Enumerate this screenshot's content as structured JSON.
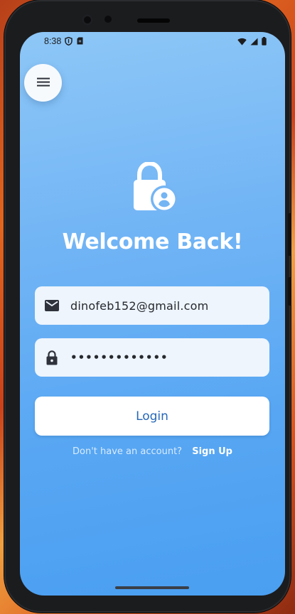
{
  "status_bar": {
    "time": "8:38",
    "left_icons": [
      "shield-icon",
      "sim-card-icon"
    ],
    "right_icons": [
      "wifi-icon",
      "cellular-signal-icon",
      "battery-icon"
    ]
  },
  "menu_button": {
    "icon": "hamburger-menu-icon"
  },
  "hero": {
    "icon": "lock-account-icon"
  },
  "title": "Welcome Back!",
  "email_field": {
    "icon": "email-icon",
    "value": "dinofeb152@gmail.com"
  },
  "password_field": {
    "icon": "lock-icon",
    "value": "•••••••••••••"
  },
  "login_button": {
    "label": "Login"
  },
  "signup": {
    "prompt": "Don't have an account?",
    "link_label": "Sign Up"
  },
  "colors": {
    "accent": "#2667B8",
    "field_background": "#EEF5FD",
    "gradient_top": "#8EC7F7",
    "gradient_bottom": "#4A9FF1"
  }
}
